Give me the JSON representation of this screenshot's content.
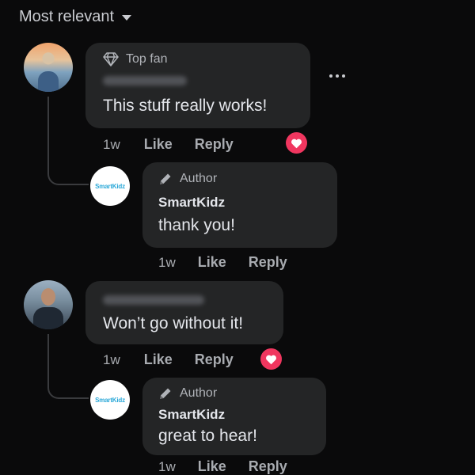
{
  "sort": {
    "label": "Most relevant"
  },
  "comments": [
    {
      "badge": "Top fan",
      "text": "This stuff really works!",
      "time": "1w",
      "like": "Like",
      "reply": "Reply",
      "reply_comment": {
        "avatar_text": "SmartKidz",
        "badge": "Author",
        "name": "SmartKidz",
        "text": "thank you!",
        "time": "1w",
        "like": "Like",
        "reply": "Reply"
      }
    },
    {
      "text": "Won’t go without it!",
      "time": "1w",
      "like": "Like",
      "reply": "Reply",
      "reply_comment": {
        "avatar_text": "SmartKidz",
        "badge": "Author",
        "name": "SmartKidz",
        "text": "great to hear!",
        "time": "1w",
        "like": "Like",
        "reply": "Reply"
      }
    }
  ],
  "colors": {
    "background": "#0a0a0b",
    "bubble": "#242526",
    "reaction": "#f0365f",
    "brand": "#2aa8d8"
  }
}
